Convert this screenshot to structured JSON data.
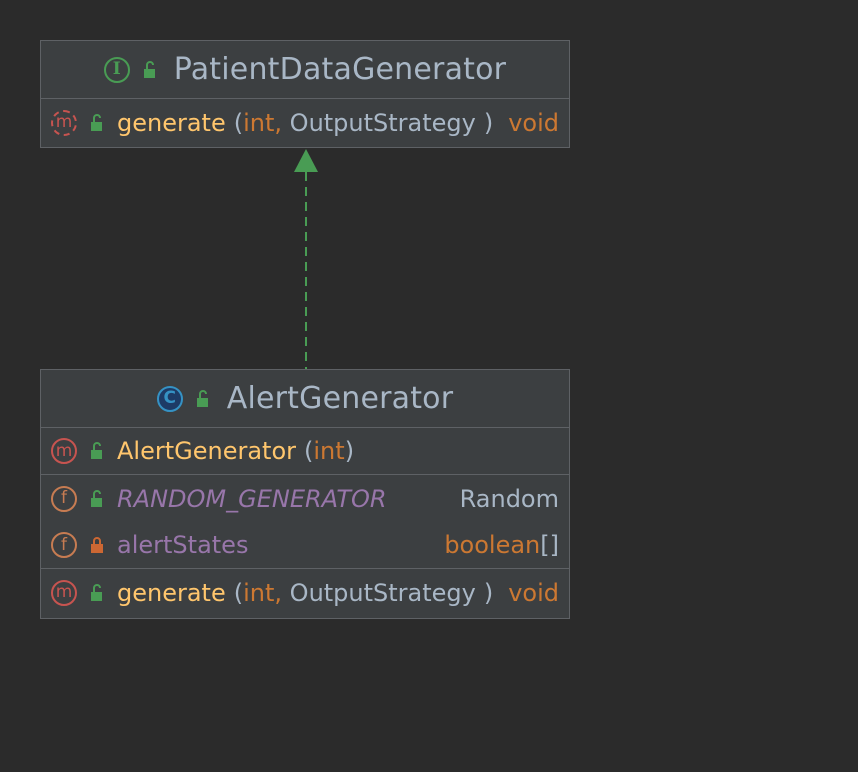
{
  "interface": {
    "name": "PatientDataGenerator",
    "kind_icon": "interface-icon",
    "kind_letter": "I",
    "methods": [
      {
        "name": "generate",
        "params": [
          "int",
          "OutputStrategy"
        ],
        "return_type": "void",
        "abstract": true
      }
    ]
  },
  "class": {
    "name": "AlertGenerator",
    "kind_icon": "class-icon",
    "kind_letter": "C",
    "constructors": [
      {
        "name": "AlertGenerator",
        "params": [
          "int"
        ]
      }
    ],
    "fields": [
      {
        "name": "RANDOM_GENERATOR",
        "type": "Random",
        "static": true,
        "visibility": "public"
      },
      {
        "name": "alertStates",
        "type": "boolean",
        "array_suffix": "[]",
        "static": false,
        "visibility": "private"
      }
    ],
    "methods": [
      {
        "name": "generate",
        "params": [
          "int",
          "OutputStrategy"
        ],
        "return_type": "void"
      }
    ]
  },
  "icons": {
    "method_letter": "m",
    "field_letter": "f"
  },
  "relationship": {
    "type": "realization",
    "from": "AlertGenerator",
    "to": "PatientDataGenerator",
    "line_style": "dashed",
    "color": "#499c54"
  },
  "colors": {
    "background": "#2b2b2b",
    "box_fill": "#3c3f41",
    "box_border": "#5e6165",
    "method_name": "#ffc66d",
    "keyword_type": "#cc7832",
    "plain_type": "#a9b7c6",
    "field_name": "#9876aa",
    "unlocked_visibility": "#499c54",
    "locked_visibility": "#cc6733"
  }
}
